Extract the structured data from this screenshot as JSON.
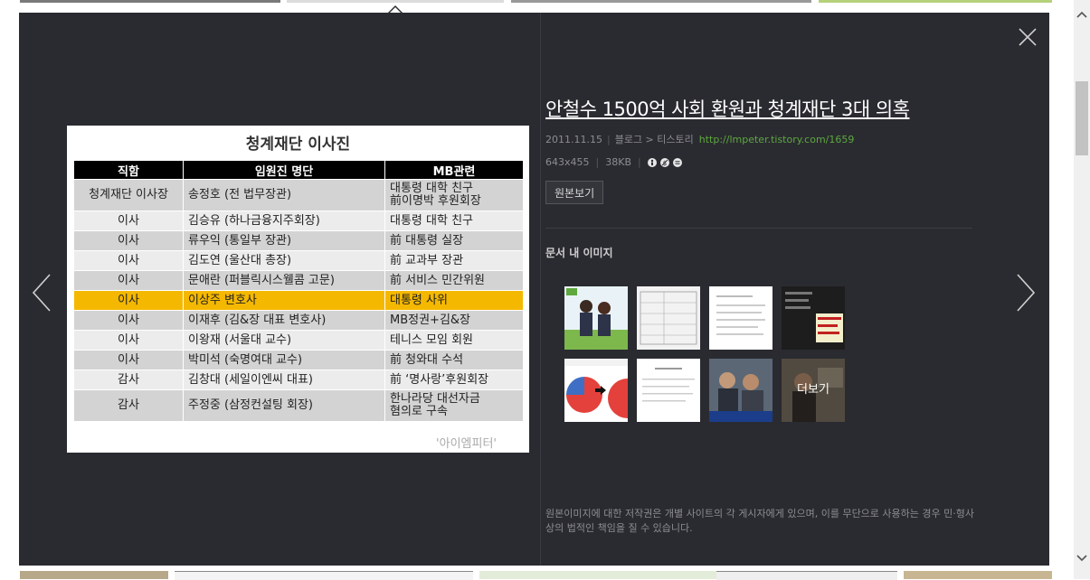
{
  "viewer": {
    "title": "안철수 1500억 사회 환원과 청계재단 3대 의혹",
    "date": "2011.11.15",
    "source": "블로그 > 티스토리",
    "url": "http://lmpeter.tistory.com/1659",
    "dimensions": "643x455",
    "filesize": "38KB",
    "license_icons": [
      "cc-by-icon",
      "noncommercial-icon",
      "no-derivatives-icon"
    ],
    "original_button": "원본보기",
    "section_title": "문서 내 이미지",
    "more_label": "더보기",
    "copyright": "원본이미지에 대한 저작권은 개별 사이트의 각 게시자에게 있으며, 이를 무단으로 사용하는 경우 민·형사상의 법적인 책임을 질 수 있습니다."
  },
  "image": {
    "title": "청계재단 이사진",
    "headers": [
      "직함",
      "임원진 명단",
      "MB관련"
    ],
    "rows": [
      [
        "청계재단 이사장",
        "송정호 (전 법무장관)",
        "대통령 대학 친구\n前이명박 후원회장"
      ],
      [
        "이사",
        "김승유 (하나금융지주회장)",
        "대통령 대학 친구"
      ],
      [
        "이사",
        "류우익 (통일부 장관)",
        "前 대통령 실장"
      ],
      [
        "이사",
        "김도연 (울산대 총장)",
        "前 교과부 장관"
      ],
      [
        "이사",
        "문애란 (퍼블릭시스웰콤 고문)",
        "前 서비스 민간위원"
      ],
      [
        "이사",
        "이상주 변호사",
        "대통령 사위"
      ],
      [
        "이사",
        "이재후 (김&장 대표 변호사)",
        "MB정권+김&장"
      ],
      [
        "이사",
        "이왕재 (서울대 교수)",
        "테니스 모임 회원"
      ],
      [
        "이사",
        "박미석 (숙명여대 교수)",
        "前 청와대 수석"
      ],
      [
        "감사",
        "김창대 (세일이엔씨 대표)",
        "前 ‘명사랑’후원회장"
      ],
      [
        "감사",
        "주정중 (삼정컨설팅 회장)",
        "한나라당 대선자금\n혐의로 구속"
      ]
    ],
    "credit": "'아이엠피터'"
  },
  "colors": {
    "viewer_bg": "#2a2b31",
    "highlight_row": "#f5b800",
    "url": "#5ea83e"
  }
}
